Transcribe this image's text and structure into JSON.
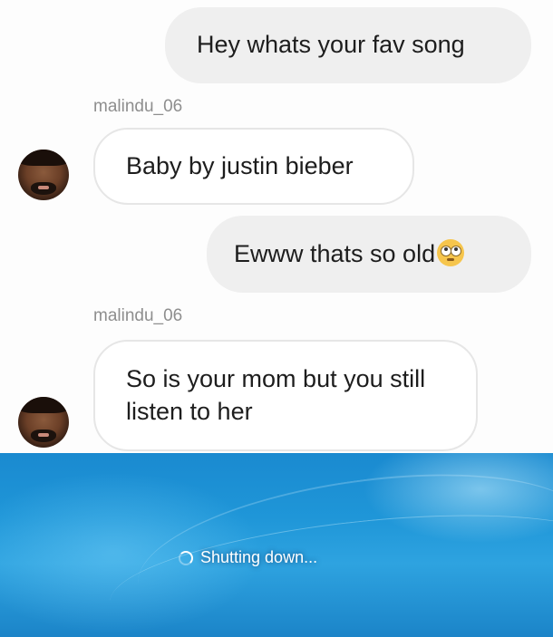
{
  "conversation": {
    "messages": [
      {
        "sender": "self",
        "text": "Hey whats your fav song"
      },
      {
        "sender": "malindu_06",
        "text": "Baby by justin bieber"
      },
      {
        "sender": "self",
        "text": "Ewww thats so old",
        "emoji": "flushed-face-icon"
      },
      {
        "sender": "malindu_06",
        "text": "So is your mom but you still listen to her"
      }
    ],
    "username_labels": [
      "malindu_06",
      "malindu_06"
    ]
  },
  "desktop": {
    "status_text": "Shutting down...",
    "status_icon": "spinner-icon"
  },
  "colors": {
    "sent_bubble": "#efefef",
    "received_bubble_border": "#e6e6e6",
    "username_text": "#8e8e8e",
    "desktop_blue": "#1f96d8"
  }
}
